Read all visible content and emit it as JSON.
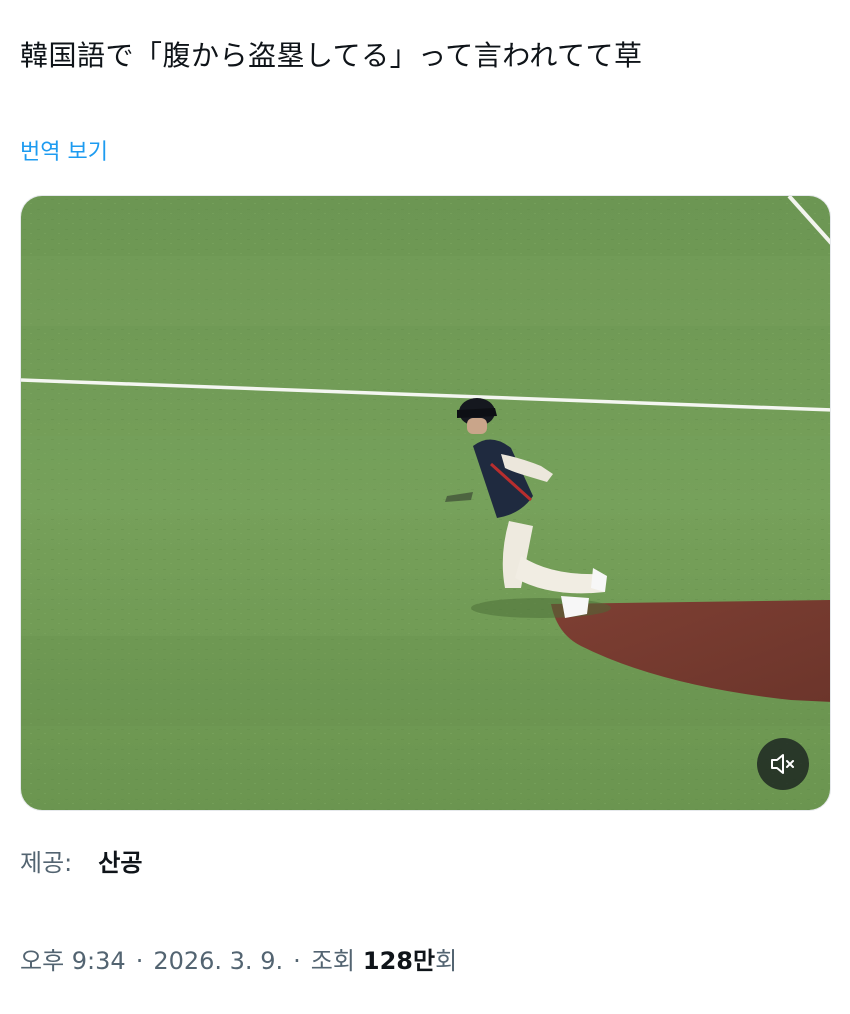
{
  "tweet": {
    "text": "韓国語で「腹から盗塁してる」って言われてて草",
    "translate_label": "번역 보기"
  },
  "media": {
    "kind": "video",
    "muted": true,
    "mute_icon": "speaker-muted-icon"
  },
  "provider": {
    "label": "제공:",
    "name": "산공"
  },
  "meta": {
    "time": "오후 9:34",
    "separator": "·",
    "date": "2026. 3. 9.",
    "views_prefix": "조회",
    "views_count": "128만",
    "views_suffix": "회"
  },
  "colors": {
    "link": "#1d9bf0",
    "secondary_text": "#536471",
    "primary_text": "#0f1419",
    "grass": "#6f9a55",
    "dirt": "#7a3c30"
  }
}
